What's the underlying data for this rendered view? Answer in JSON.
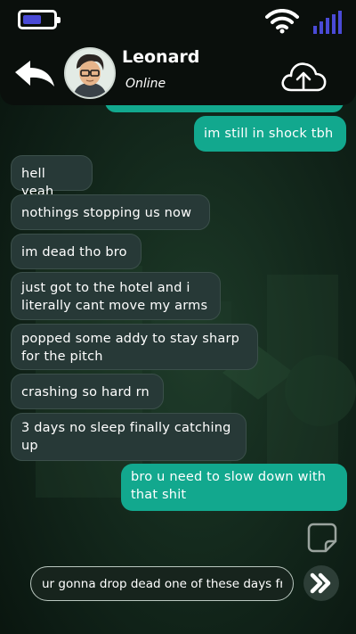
{
  "status_bar": {
    "battery_level": 0.62,
    "battery_color": "#4a4ad6",
    "wifi_icon": "wifi-icon",
    "signal_icon": "signal-bars-icon",
    "signal_color": "#4a4ad6"
  },
  "header": {
    "contact_name": "Leonard",
    "contact_status": "Online",
    "back_icon": "back-arrow-icon",
    "upload_icon": "cloud-upload-icon"
  },
  "messages": [
    {
      "side": "sent",
      "text": "im still in shock tbh"
    },
    {
      "side": "received",
      "text": "hell yeah"
    },
    {
      "side": "received",
      "text": "nothings stopping us now"
    },
    {
      "side": "received",
      "text": "im dead tho bro"
    },
    {
      "side": "received",
      "text": "just got to the hotel and i\nliterally cant move my arms"
    },
    {
      "side": "received",
      "text": "popped some addy to stay sharp\nfor the pitch"
    },
    {
      "side": "received",
      "text": "crashing so hard rn"
    },
    {
      "side": "received",
      "text": "3 days no sleep finally catching\nup"
    },
    {
      "side": "sent",
      "text": "bro u need to slow down with\nthat shit"
    }
  ],
  "composer": {
    "draft": "ur gonna drop dead one of these days fr",
    "sticker_icon": "sticker-icon",
    "send_icon": "double-chevron-send-icon"
  },
  "colors": {
    "sent_bubble": "#12a88e",
    "received_bubble": "#273937",
    "background": "#142a1d"
  }
}
